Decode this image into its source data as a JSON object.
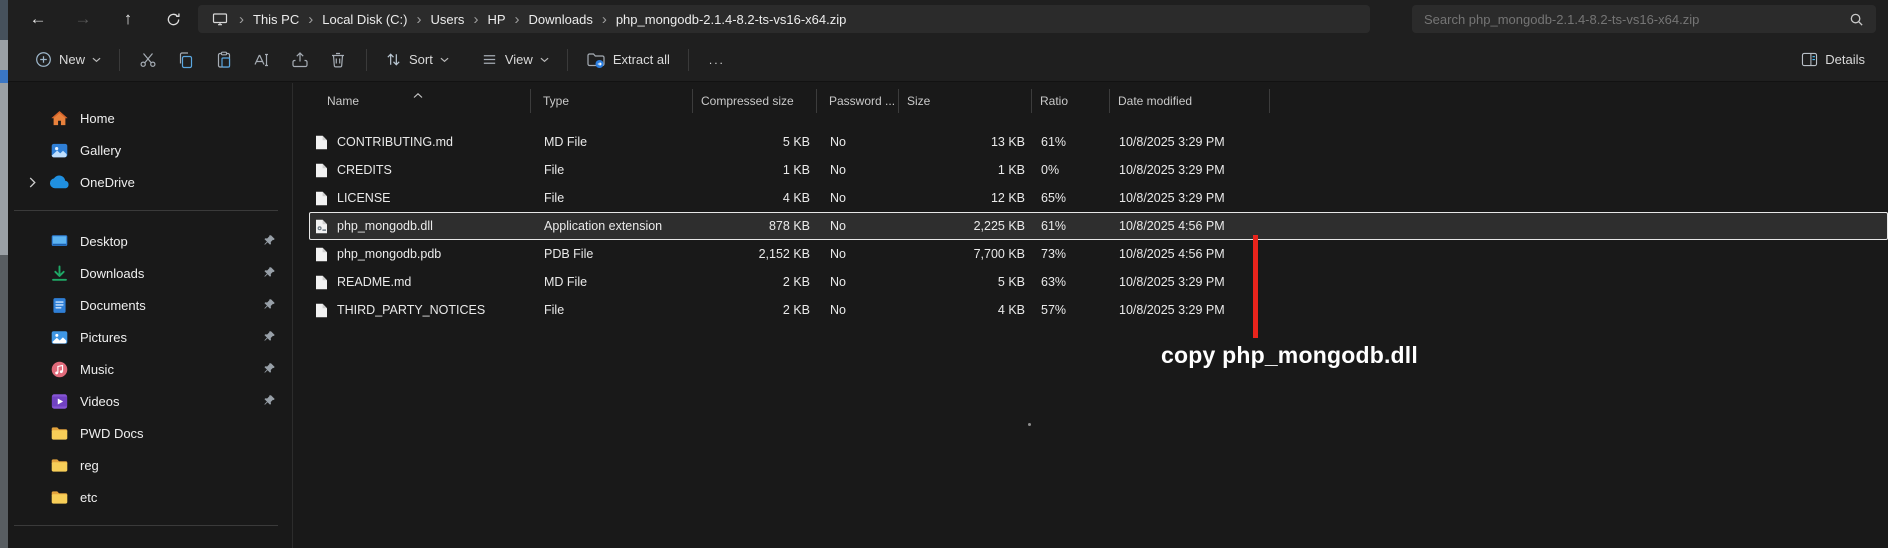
{
  "titlebar": {
    "breadcrumbs": [
      "This PC",
      "Local Disk (C:)",
      "Users",
      "HP",
      "Downloads",
      "php_mongodb-2.1.4-8.2-ts-vs16-x64.zip"
    ],
    "search_placeholder": "Search php_mongodb-2.1.4-8.2-ts-vs16-x64.zip"
  },
  "toolbar": {
    "new_label": "New",
    "sort_label": "Sort",
    "view_label": "View",
    "extract_all_label": "Extract all",
    "more_label": "...",
    "details_label": "Details"
  },
  "sidebar": {
    "items": [
      {
        "label": "Home",
        "icon": "home-icon",
        "pinned": false,
        "expandable": false
      },
      {
        "label": "Gallery",
        "icon": "gallery-icon",
        "pinned": false,
        "expandable": false
      },
      {
        "label": "OneDrive",
        "icon": "onedrive-icon",
        "pinned": false,
        "expandable": true
      },
      {
        "separator": true
      },
      {
        "label": "Desktop",
        "icon": "desktop-icon",
        "pinned": true,
        "expandable": false
      },
      {
        "label": "Downloads",
        "icon": "downloads-icon",
        "pinned": true,
        "expandable": false
      },
      {
        "label": "Documents",
        "icon": "documents-icon",
        "pinned": true,
        "expandable": false
      },
      {
        "label": "Pictures",
        "icon": "pictures-icon",
        "pinned": true,
        "expandable": false
      },
      {
        "label": "Music",
        "icon": "music-icon",
        "pinned": true,
        "expandable": false
      },
      {
        "label": "Videos",
        "icon": "videos-icon",
        "pinned": true,
        "expandable": false
      },
      {
        "label": "PWD Docs",
        "icon": "folder-icon",
        "pinned": false,
        "expandable": false
      },
      {
        "label": "reg",
        "icon": "folder-icon",
        "pinned": false,
        "expandable": false
      },
      {
        "label": "etc",
        "icon": "folder-icon",
        "pinned": false,
        "expandable": false
      },
      {
        "separator": true
      }
    ]
  },
  "table": {
    "columns": [
      "Name",
      "Type",
      "Compressed size",
      "Password ...",
      "Size",
      "Ratio",
      "Date modified"
    ],
    "sort": {
      "column": "Name",
      "direction": "ascending"
    },
    "rows": [
      {
        "name": "CONTRIBUTING.md",
        "type": "MD File",
        "compressed_size": "5 KB",
        "password": "No",
        "size": "13 KB",
        "ratio": "61%",
        "date_modified": "10/8/2025 3:29 PM",
        "icon": "file-icon",
        "selected": false
      },
      {
        "name": "CREDITS",
        "type": "File",
        "compressed_size": "1 KB",
        "password": "No",
        "size": "1 KB",
        "ratio": "0%",
        "date_modified": "10/8/2025 3:29 PM",
        "icon": "file-icon",
        "selected": false
      },
      {
        "name": "LICENSE",
        "type": "File",
        "compressed_size": "4 KB",
        "password": "No",
        "size": "12 KB",
        "ratio": "65%",
        "date_modified": "10/8/2025 3:29 PM",
        "icon": "file-icon",
        "selected": false
      },
      {
        "name": "php_mongodb.dll",
        "type": "Application extension",
        "compressed_size": "878 KB",
        "password": "No",
        "size": "2,225 KB",
        "ratio": "61%",
        "date_modified": "10/8/2025 4:56 PM",
        "icon": "dll-icon",
        "selected": true
      },
      {
        "name": "php_mongodb.pdb",
        "type": "PDB File",
        "compressed_size": "2,152 KB",
        "password": "No",
        "size": "7,700 KB",
        "ratio": "73%",
        "date_modified": "10/8/2025 4:56 PM",
        "icon": "file-icon",
        "selected": false
      },
      {
        "name": "README.md",
        "type": "MD File",
        "compressed_size": "2 KB",
        "password": "No",
        "size": "5 KB",
        "ratio": "63%",
        "date_modified": "10/8/2025 3:29 PM",
        "icon": "file-icon",
        "selected": false
      },
      {
        "name": "THIRD_PARTY_NOTICES",
        "type": "File",
        "compressed_size": "2 KB",
        "password": "No",
        "size": "4 KB",
        "ratio": "57%",
        "date_modified": "10/8/2025 3:29 PM",
        "icon": "file-icon",
        "selected": false
      }
    ]
  },
  "annotation": {
    "text": "copy php_mongodb.dll",
    "line_color": "#e8241c"
  },
  "colors": {
    "accent_blue": "#4cc2ff",
    "selection_border": "#e6e6e6",
    "background": "#191919"
  }
}
